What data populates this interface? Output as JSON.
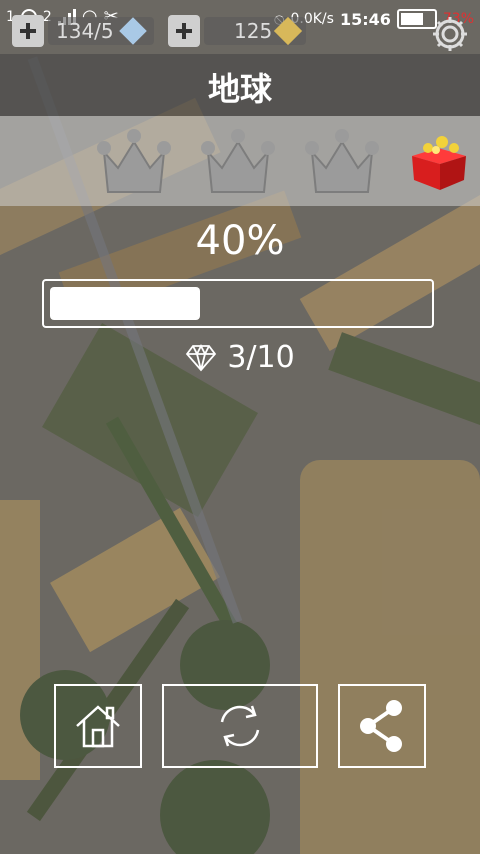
{
  "status_bar": {
    "sim1": "1",
    "sim2": "2",
    "speed": "0.0K/s",
    "time": "15:46",
    "battery": "73%"
  },
  "currency": {
    "cubes": "134/5",
    "gold": "125"
  },
  "level": {
    "title": "地球",
    "crowns_earned": 0,
    "crowns_total": 3,
    "progress_percent_label": "40%",
    "progress": 0.4,
    "gems": "3/10"
  },
  "icons": {
    "settings": "gear-icon",
    "gift": "gift-box-icon",
    "gem": "diamond-icon",
    "home": "home-icon",
    "restart": "restart-icon",
    "share": "share-icon"
  },
  "colors": {
    "gift_red": "#d81e1e",
    "gift_gold": "#f2d23a",
    "crown_gray": "#9b9b9b"
  }
}
